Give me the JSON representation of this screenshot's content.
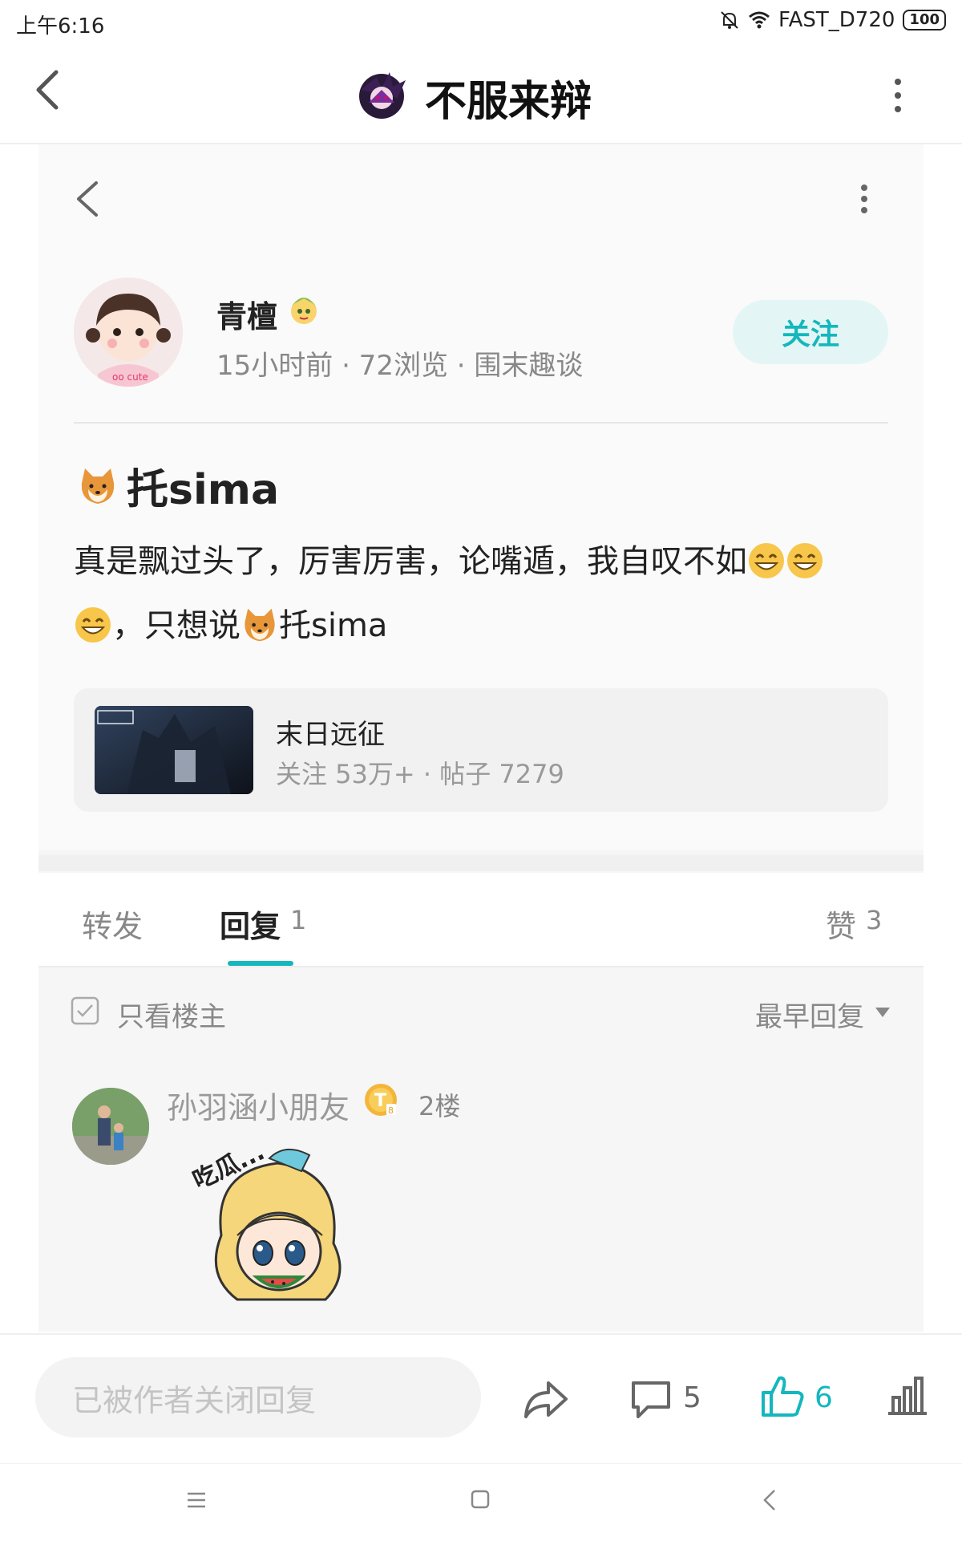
{
  "status_bar": {
    "time": "上午6:16",
    "wifi_name": "FAST_D720",
    "battery": "100"
  },
  "nav": {
    "title": "不服来辩",
    "logo_icon": "anime-character-avatar-icon",
    "back_icon": "chevron-left-icon",
    "more_icon": "vertical-dots-icon"
  },
  "post": {
    "author": "青檀",
    "meta": "15小时前 · 72浏览 · 围末趣谈",
    "follow_label": "关注",
    "title": "托sima",
    "body_part1": "真是飘过头了，厉害厉害，论嘴遁，我自叹不如",
    "body_part2": "，只想说",
    "body_part3": "托sima",
    "forum": {
      "name": "末日远征",
      "stats": "关注 53万+ · 帖子 7279"
    }
  },
  "tabs": {
    "forward": "转发",
    "reply": "回复",
    "reply_count": "1",
    "like": "赞",
    "like_count": "3"
  },
  "filter": {
    "only_host": "只看楼主",
    "sort": "最早回复"
  },
  "reply": {
    "author": "孙羽涵小朋友",
    "floor": "2楼",
    "sticker_text": "吃瓜..."
  },
  "bottom_bar": {
    "placeholder": "已被作者关闭回复",
    "comment_count": "5",
    "like_count": "6"
  },
  "colors": {
    "accent": "#14b7bd",
    "follow_bg": "#e3f6f5",
    "muted": "#888888"
  }
}
